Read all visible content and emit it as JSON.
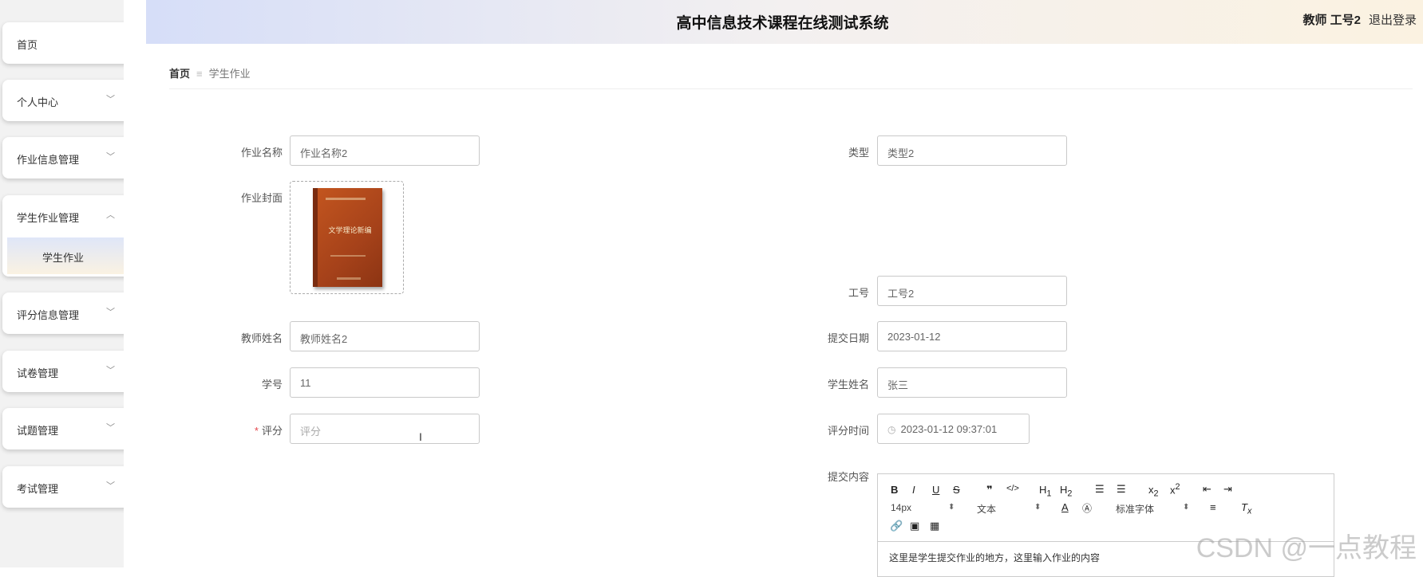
{
  "header": {
    "title": "高中信息技术课程在线测试系统",
    "user": "教师 工号2",
    "logout": "退出登录"
  },
  "sidebar": {
    "items": [
      {
        "label": "首页"
      },
      {
        "label": "个人中心"
      },
      {
        "label": "作业信息管理"
      },
      {
        "label": "学生作业管理",
        "sub": "学生作业"
      },
      {
        "label": "评分信息管理"
      },
      {
        "label": "试卷管理"
      },
      {
        "label": "试题管理"
      },
      {
        "label": "考试管理"
      }
    ]
  },
  "breadcrumb": {
    "home": "首页",
    "current": "学生作业"
  },
  "form": {
    "name_label": "作业名称",
    "name_value": "作业名称2",
    "type_label": "类型",
    "type_value": "类型2",
    "cover_label": "作业封面",
    "cover_book_title": "文学理论新编",
    "empno_label": "工号",
    "empno_value": "工号2",
    "teacher_label": "教师姓名",
    "teacher_value": "教师姓名2",
    "date_label": "提交日期",
    "date_value": "2023-01-12",
    "stuno_label": "学号",
    "stuno_value": "11",
    "stuname_label": "学生姓名",
    "stuname_value": "张三",
    "score_required": "*",
    "score_label": "评分",
    "score_placeholder": "评分",
    "scoretime_label": "评分时间",
    "scoretime_value": "2023-01-12 09:37:01",
    "content_label": "提交内容"
  },
  "editor": {
    "buttons": [
      "B",
      "I",
      "U",
      "S",
      "99",
      "</>",
      "H1",
      "H2",
      "ol",
      "ul",
      "x2",
      "x2",
      "outdent",
      "indent"
    ],
    "size": "14px",
    "format": "文本",
    "font": "标准字体",
    "content": "这里是学生提交作业的地方，这里输入作业的内容"
  },
  "watermark": "CSDN @一点教程"
}
